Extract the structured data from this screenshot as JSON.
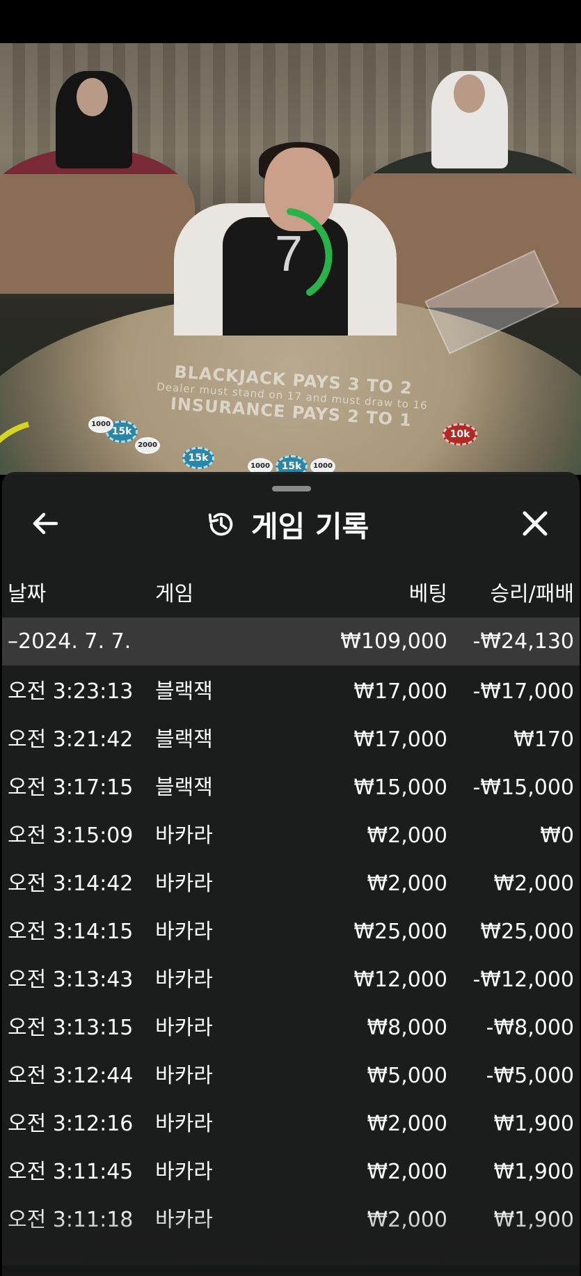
{
  "live_view": {
    "timer_value": "7",
    "table_text": {
      "line1": "BLACKJACK PAYS 3 TO 2",
      "line2": "Dealer must stand on 17 and must draw to 16",
      "line3": "INSURANCE PAYS 2 TO 1"
    },
    "chips": [
      "15k",
      "15k",
      "15k",
      "10k",
      "1000",
      "2000",
      "1000",
      "1000"
    ]
  },
  "panel": {
    "title": "게임 기록",
    "icons": {
      "back": "arrow-left-icon",
      "history": "history-clock-icon",
      "close": "close-icon"
    },
    "columns": {
      "date": "날짜",
      "game": "게임",
      "bet": "베팅",
      "win_loss": "승리/패배"
    },
    "summary": {
      "date": "–2024. 7. 7.",
      "bet": "₩109,000",
      "win_loss": "-₩24,130"
    },
    "rows": [
      {
        "time": "오전 3:23:13",
        "game": "블랙잭",
        "bet": "₩17,000",
        "win_loss": "-₩17,000"
      },
      {
        "time": "오전 3:21:42",
        "game": "블랙잭",
        "bet": "₩17,000",
        "win_loss": "₩170"
      },
      {
        "time": "오전 3:17:15",
        "game": "블랙잭",
        "bet": "₩15,000",
        "win_loss": "-₩15,000"
      },
      {
        "time": "오전 3:15:09",
        "game": "바카라",
        "bet": "₩2,000",
        "win_loss": "₩0"
      },
      {
        "time": "오전 3:14:42",
        "game": "바카라",
        "bet": "₩2,000",
        "win_loss": "₩2,000"
      },
      {
        "time": "오전 3:14:15",
        "game": "바카라",
        "bet": "₩25,000",
        "win_loss": "₩25,000"
      },
      {
        "time": "오전 3:13:43",
        "game": "바카라",
        "bet": "₩12,000",
        "win_loss": "-₩12,000"
      },
      {
        "time": "오전 3:13:15",
        "game": "바카라",
        "bet": "₩8,000",
        "win_loss": "-₩8,000"
      },
      {
        "time": "오전 3:12:44",
        "game": "바카라",
        "bet": "₩5,000",
        "win_loss": "-₩5,000"
      },
      {
        "time": "오전 3:12:16",
        "game": "바카라",
        "bet": "₩2,000",
        "win_loss": "₩1,900"
      },
      {
        "time": "오전 3:11:45",
        "game": "바카라",
        "bet": "₩2,000",
        "win_loss": "₩1,900"
      },
      {
        "time": "오전 3:11:18",
        "game": "바카라",
        "bet": "₩2,000",
        "win_loss": "₩1,900"
      }
    ]
  }
}
